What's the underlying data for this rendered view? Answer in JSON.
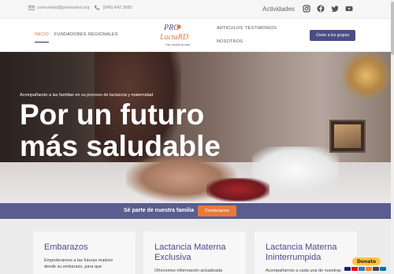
{
  "topbar": {
    "email": "comunidad@prolactard.org",
    "phone": "(849) 642 3682",
    "activities_label": "Actividades",
    "social": [
      "instagram-icon",
      "facebook-icon",
      "twitter-icon",
      "youtube-icon"
    ]
  },
  "logo": {
    "text_top": "PRO",
    "text_mid": "LactaRD",
    "tagline": "Una cuestión de amor"
  },
  "nav": {
    "items": [
      "INICIO",
      "FUNDADORES",
      "REGIONALES",
      "ARTICULOS",
      "TESTIMONIOS",
      "NOSOTROS"
    ],
    "cta": "Únete a los grupos"
  },
  "hero": {
    "subtitle": "Acompañando a las familias en su proceso de lactancia y maternidad",
    "title_line1": "Por un futuro",
    "title_line2": "más saludable"
  },
  "strip": {
    "text": "Sé parte de nuestra familia",
    "button": "Contáctanos"
  },
  "cards": [
    {
      "title": "Embarazos",
      "text_line1": "Empoderamos a las futuras madres",
      "text_line2": "desde su embarazo, para que"
    },
    {
      "title_line1": "Lactancia Materna",
      "title_line2": "Exclusiva",
      "text_line1": "Ofrecemos información actualizada"
    },
    {
      "title_line1": "Lactancia Materna",
      "title_line2": "Ininterrumpida",
      "text_line1": "Acompañamos a cada una de nuestras"
    }
  ],
  "donate": {
    "label": "Donate",
    "colors": {
      "button": "#ffc439",
      "accent": "#4b4d86",
      "orange": "#e8793e"
    }
  }
}
